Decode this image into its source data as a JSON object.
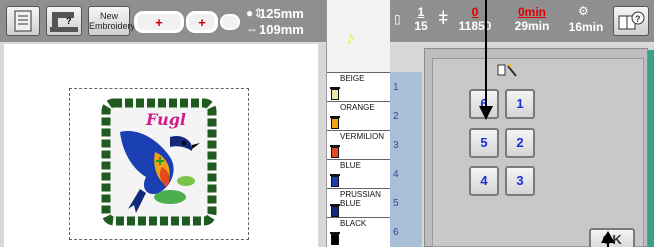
{
  "toolbar": {
    "new_label_1": "New",
    "new_label_2": "Embroidery",
    "frame_plus": "+",
    "size_width": "125mm",
    "size_height": "109mm",
    "needle_counter": {
      "current": "1",
      "total": "15"
    },
    "stitch_counter": {
      "current": "0",
      "total": "11850"
    },
    "time_counter": {
      "current": "0min",
      "total": "29min"
    },
    "stop_time": "16min"
  },
  "thread_colors": [
    {
      "name": "BEIGE",
      "color": "#efe8a8",
      "index": "1"
    },
    {
      "name": "ORANGE",
      "color": "#f2a11a",
      "index": "2"
    },
    {
      "name": "VERMILION",
      "color": "#e34a1e",
      "index": "3"
    },
    {
      "name": "BLUE",
      "color": "#1a3fb3",
      "index": "4"
    },
    {
      "name": "PRUSSIAN BLUE",
      "name_line1": "PRUSSIAN",
      "name_line2": "BLUE",
      "color": "#132a7a",
      "index": "5"
    },
    {
      "name": "BLACK",
      "color": "#000000",
      "index": "6"
    }
  ],
  "design": {
    "text": "Fugl"
  },
  "keypad": {
    "keys": [
      "6",
      "1",
      "5",
      "2",
      "4",
      "3"
    ],
    "ok_label": "OK"
  },
  "colors": {
    "toolbar_bg": "#8f8f8f",
    "key_text": "#1b2fd6",
    "accent_green": "#3aa088",
    "number_column": "#a9bfd8"
  }
}
